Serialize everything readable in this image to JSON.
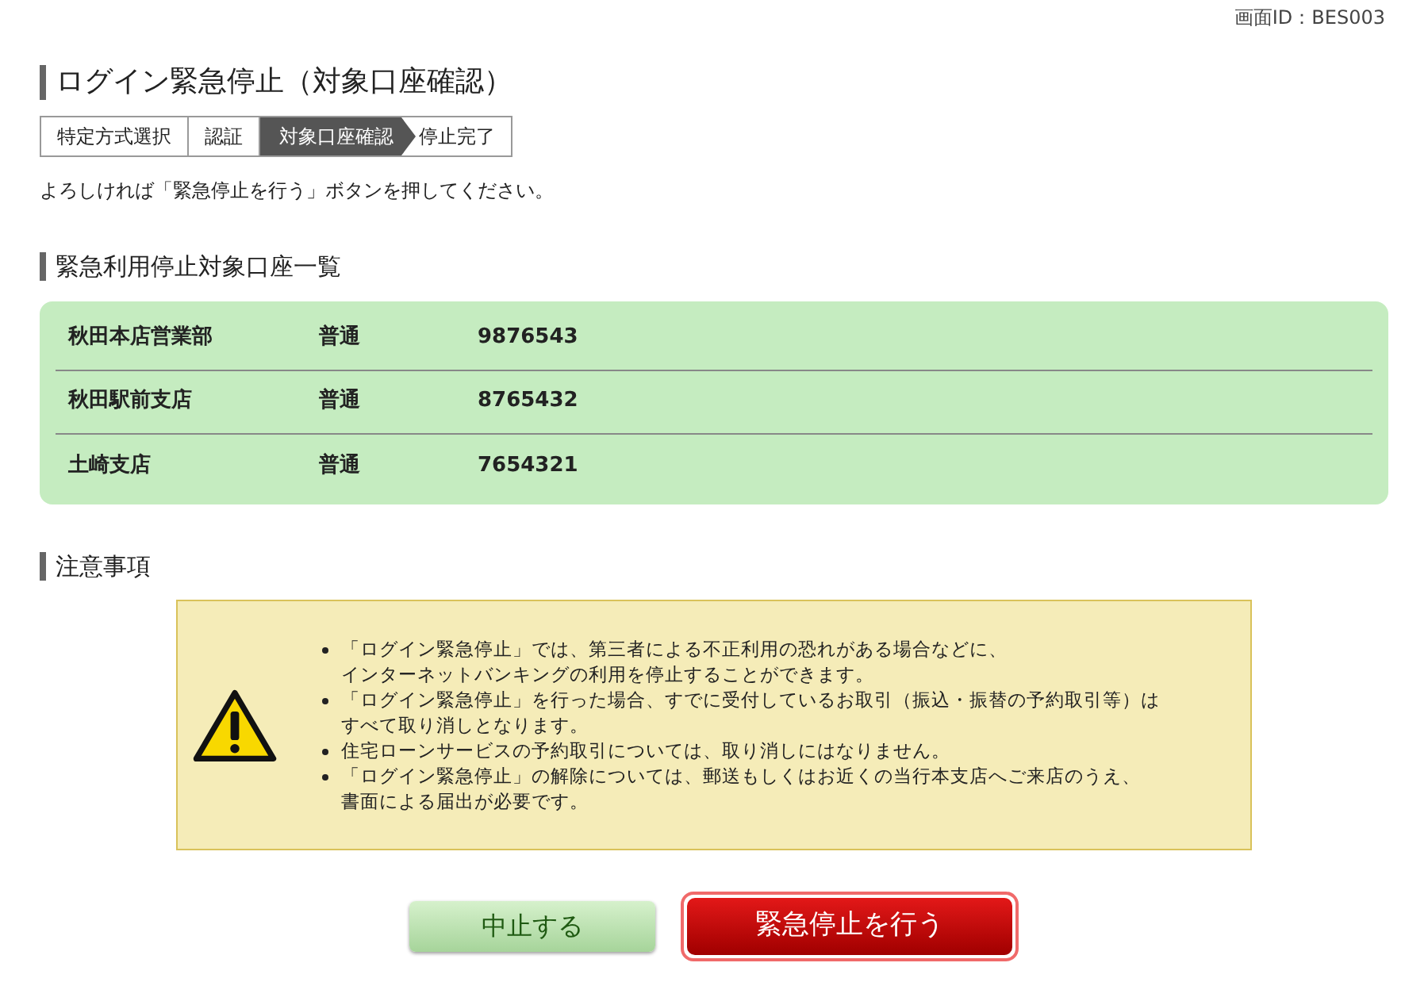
{
  "screen_id": "画面ID：BES003",
  "title": "ログイン緊急停止（対象口座確認）",
  "steps": [
    {
      "label": "特定方式選択",
      "selected": false
    },
    {
      "label": "認証",
      "selected": false
    },
    {
      "label": "対象口座確認",
      "selected": true
    },
    {
      "label": "停止完了",
      "selected": false
    }
  ],
  "instruction": "よろしければ「緊急停止を行う」ボタンを押してください。",
  "accounts": {
    "heading": "緊急利用停止対象口座一覧",
    "rows": [
      {
        "branch": "秋田本店営業部",
        "type": "普通",
        "number": "9876543"
      },
      {
        "branch": "秋田駅前支店",
        "type": "普通",
        "number": "8765432"
      },
      {
        "branch": "土崎支店",
        "type": "普通",
        "number": "7654321"
      }
    ]
  },
  "notes": {
    "heading": "注意事項",
    "items": [
      {
        "lines": [
          "「ログイン緊急停止」では、第三者による不正利用の恐れがある場合などに、",
          "インターネットバンキングの利用を停止することができます。"
        ]
      },
      {
        "lines": [
          "「ログイン緊急停止」を行った場合、すでに受付しているお取引（振込・振替の予約取引等）は",
          "すべて取り消しとなります。"
        ]
      },
      {
        "lines": [
          "住宅ローンサービスの予約取引については、取り消しにはなりません。"
        ]
      },
      {
        "lines": [
          "「ログイン緊急停止」の解除については、郵送もしくはお近くの当行本支店へご来店のうえ、",
          "書面による届出が必要です。"
        ]
      }
    ]
  },
  "buttons": [
    {
      "kind": "cancel",
      "label": "中止する"
    },
    {
      "kind": "primary",
      "label": "緊急停止を行う"
    }
  ]
}
